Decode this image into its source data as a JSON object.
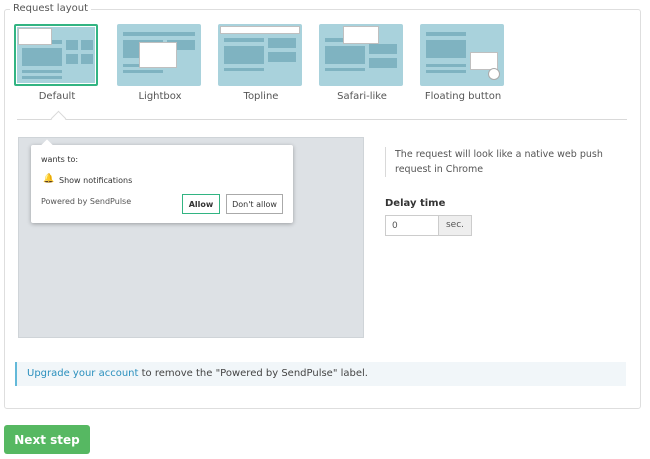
{
  "section": {
    "legend": "Request layout"
  },
  "layouts": [
    {
      "label": "Default",
      "selected": true
    },
    {
      "label": "Lightbox",
      "selected": false
    },
    {
      "label": "Topline",
      "selected": false
    },
    {
      "label": "Safari-like",
      "selected": false
    },
    {
      "label": "Floating button",
      "selected": false
    }
  ],
  "preview": {
    "wants_text": "wants to:",
    "notification_icon": "bell-icon",
    "show_notifications": "Show notifications",
    "powered_by": "Powered by SendPulse",
    "allow_label": "Allow",
    "deny_label": "Don't allow"
  },
  "info": {
    "text": "The request will look like a native web push request in Chrome"
  },
  "delay": {
    "label": "Delay time",
    "value": "0",
    "unit": "sec."
  },
  "notice": {
    "link_text": "Upgrade your account",
    "rest_text": " to remove the \"Powered by SendPulse\" label."
  },
  "actions": {
    "next_label": "Next step"
  },
  "colors": {
    "accent": "#32b482",
    "next_button": "#56b862",
    "thumb": "#a9d2dc",
    "link": "#2a8fbd"
  }
}
